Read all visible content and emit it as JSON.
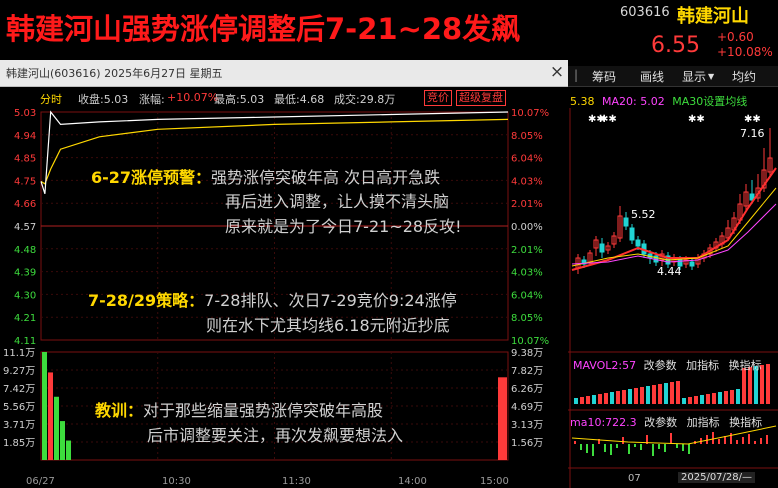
{
  "header": {
    "title": "韩建河山强势涨停调整后7-21~28发飙",
    "code": "603616",
    "name": "韩建河山",
    "price": "6.55",
    "change": "+0.60",
    "change_pct": "+10.08%"
  },
  "window": {
    "title": "韩建河山(603616) 2025年6月27日 星期五",
    "close": "×"
  },
  "infobar": {
    "mode": "分时",
    "close_label": "收盘:5.03",
    "pct_label": "涨幅:",
    "pct_value": "+10.07%",
    "high_label": "最高:5.03",
    "low_label": "最低:4.68",
    "vol_label": "成交:29.8万",
    "btn_auction": "竞价",
    "btn_replay": "超级复盘"
  },
  "price_axis": {
    "left": [
      "5.03",
      "4.94",
      "4.85",
      "4.75",
      "4.66",
      "4.57",
      "4.48",
      "4.39",
      "4.30",
      "4.21",
      "4.11"
    ],
    "right": [
      "10.07%",
      "8.05%",
      "6.04%",
      "4.03%",
      "2.01%",
      "0.00%",
      "2.01%",
      "4.03%",
      "6.04%",
      "8.05%",
      "10.07%"
    ]
  },
  "volume_axis": {
    "left": [
      "11.1万",
      "9.27万",
      "7.42万",
      "5.56万",
      "3.71万",
      "1.85万"
    ],
    "right": [
      "9.38万",
      "7.82万",
      "6.26万",
      "4.69万",
      "3.13万",
      "1.56万"
    ]
  },
  "time_axis": [
    "06/27",
    "10:30",
    "11:30",
    "14:00",
    "15:00"
  ],
  "notes": {
    "warn_title": "6-27涨停预警：",
    "warn_l1": "强势涨停突破年高   次日高开急跌",
    "warn_l2": "再后进入调整，让人摸不清头脑",
    "warn_l3": "原来就是为了今日7-21~28反攻!",
    "strat_title": "7-28/29策略：",
    "strat_l1": "7-28排队、次日7-29竞价9:24涨停",
    "strat_l2": "则在水下尤其均线6.18元附近抄底",
    "lesson_title": "教训：",
    "lesson_l1": "对于那些缩量强势涨停突破年高股",
    "lesson_l2": "后市调整要关注，再次发飙要想法入"
  },
  "right_panel": {
    "toolbar": [
      "筹码",
      "画线",
      "显示",
      "均约"
    ],
    "ma_bar": {
      "a": "5.38",
      "b": "MA20: 5.02",
      "c": "MA30设置均线"
    },
    "peak_label": "7.16",
    "mid_label": "5.52",
    "low_label": "4.44",
    "vol_bar": {
      "name": "MAVOL2:57",
      "btn1": "改参数",
      "btn2": "加指标",
      "btn3": "换指标"
    },
    "macd_bar": {
      "name": "ma10:722.3",
      "btn1": "改参数",
      "btn2": "加指标",
      "btn3": "换指标"
    },
    "bottom_month": "07",
    "bottom_date": "2025/07/28/—"
  },
  "chart_data": {
    "type": "line",
    "title": "",
    "prev_close": 4.57,
    "ylim": [
      4.11,
      5.03
    ],
    "x": [
      "09:30",
      "09:32",
      "09:35",
      "09:40",
      "10:00",
      "10:30",
      "11:30",
      "14:00",
      "15:00"
    ],
    "price": [
      4.75,
      4.7,
      5.03,
      4.98,
      4.99,
      5.0,
      5.01,
      5.02,
      5.03
    ],
    "avg": [
      4.75,
      4.74,
      4.8,
      4.88,
      4.93,
      4.96,
      4.98,
      4.99,
      5.0
    ],
    "volume_early_wan": [
      11.1,
      9.0,
      6.5,
      4.0,
      2.0
    ],
    "volume_close_wan": 8.5
  },
  "colors": {
    "up": "#ff3a3a",
    "down": "#3ddc3d",
    "price_line": "#ffffff",
    "avg_line": "#ffd800",
    "title": "#ff1a1a"
  }
}
